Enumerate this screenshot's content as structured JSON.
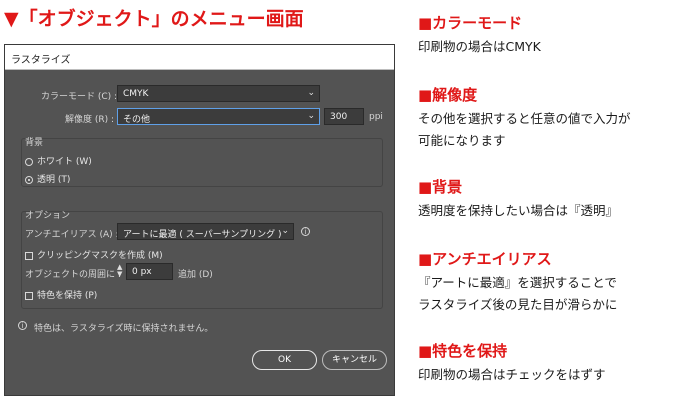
{
  "heading": "▼「オブジェクト」のメニュー画面",
  "dialog": {
    "title": "ラスタライズ",
    "color_model_label": "カラーモード (C) :",
    "color_model_value": "CMYK",
    "resolution_label": "解像度 (R) :",
    "resolution_value": "その他",
    "resolution_number": "300",
    "resolution_unit": "ppi",
    "background_group": "背景",
    "bg_white": "ホワイト (W)",
    "bg_transparent": "透明 (T)",
    "options_group": "オプション",
    "antialias_label": "アンチエイリアス (A) :",
    "antialias_value": "アートに最適 ( スーパーサンプリング )",
    "clipping_mask": "クリッピングマスクを作成 (M)",
    "around_label": "オブジェクトの周囲に :",
    "around_value": "0 px",
    "around_suffix": "追加 (D)",
    "preserve_spot": "特色を保持 (P)",
    "info_text": "特色は、ラスタライズ時に保持されません。",
    "ok_label": "OK",
    "cancel_label": "キャンセル"
  },
  "notes": [
    {
      "title": "■カラーモード",
      "lines": [
        "印刷物の場合はCMYK"
      ]
    },
    {
      "title": "■解像度",
      "lines": [
        "その他を選択すると任意の値で入力が",
        "可能になります"
      ]
    },
    {
      "title": "■背景",
      "lines": [
        "透明度を保持したい場合は『透明』"
      ]
    },
    {
      "title": "■アンチエイリアス",
      "lines": [
        "『アートに最適』を選択することで",
        "ラスタライズ後の見た目が滑らかに"
      ]
    },
    {
      "title": "■特色を保持",
      "lines": [
        "印刷物の場合はチェックをはずす"
      ]
    }
  ],
  "colors": {
    "accent": "#e01818",
    "dialog_bg": "#535353",
    "field_bg": "#3c3c3c",
    "focus": "#5fa0e8"
  }
}
